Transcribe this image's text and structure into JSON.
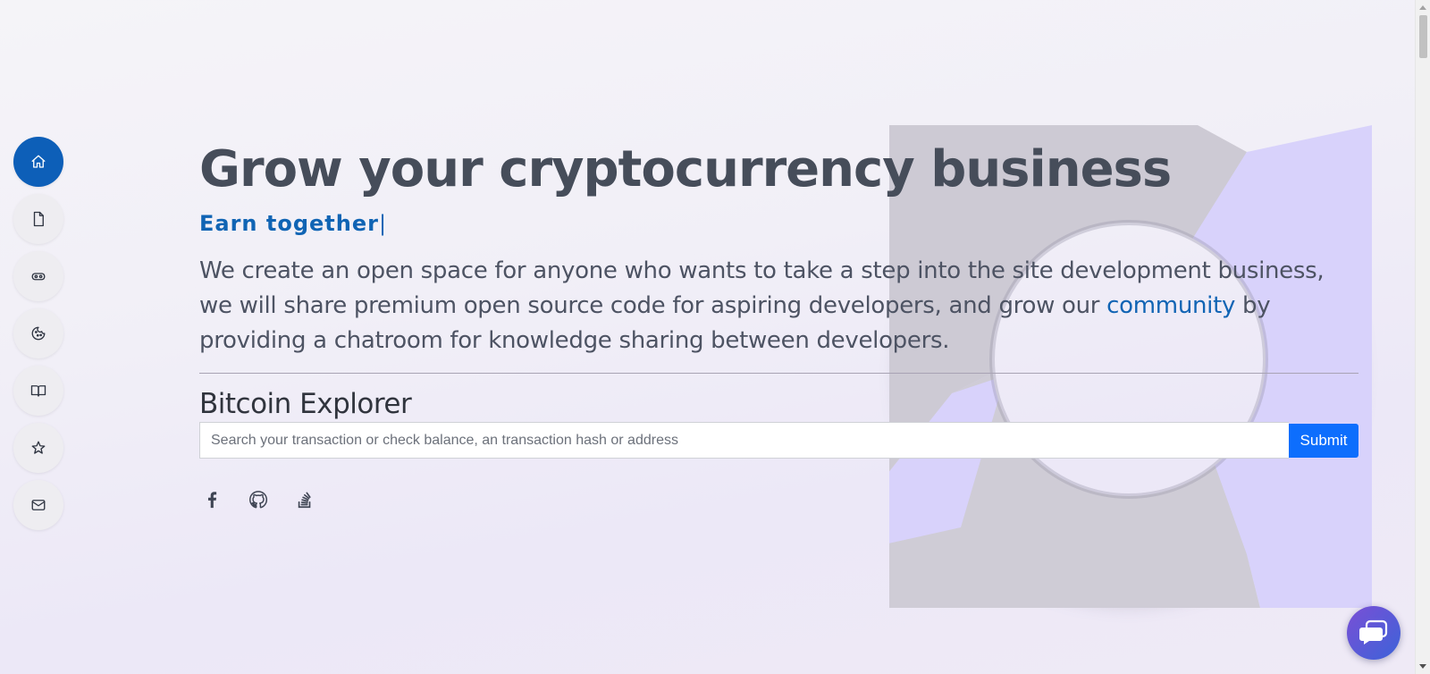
{
  "sidebar": {
    "items": [
      {
        "icon": "home-icon",
        "active": true
      },
      {
        "icon": "file-icon",
        "active": false
      },
      {
        "icon": "gamepad-icon",
        "active": false
      },
      {
        "icon": "cookie-icon",
        "active": false
      },
      {
        "icon": "book-icon",
        "active": false
      },
      {
        "icon": "star-icon",
        "active": false
      },
      {
        "icon": "mail-icon",
        "active": false
      }
    ]
  },
  "hero": {
    "headline": "Grow your cryptocurrency business",
    "subheadline": "Earn together",
    "cursor": "|",
    "description_before": "We create an open space for anyone who wants to take a step into the site development business, we will share premium open source code for aspiring developers, and grow our ",
    "description_link": "community",
    "description_after": " by providing a chatroom for knowledge sharing between developers."
  },
  "explorer": {
    "title": "Bitcoin Explorer",
    "search_placeholder": "Search your transaction or check balance, an transaction hash or address",
    "search_value": "",
    "submit_label": "Submit"
  },
  "socials": [
    {
      "icon": "facebook-icon"
    },
    {
      "icon": "github-icon"
    },
    {
      "icon": "stackoverflow-icon"
    }
  ],
  "chat": {
    "icon": "chat-icon"
  },
  "colors": {
    "accent": "#1064b4",
    "sidebar_active": "#0d5fb8",
    "submit": "#0d6efd",
    "headline": "#464d5a",
    "ring_light": "#d9d3fa",
    "ring_gray": "#cfccd6"
  }
}
